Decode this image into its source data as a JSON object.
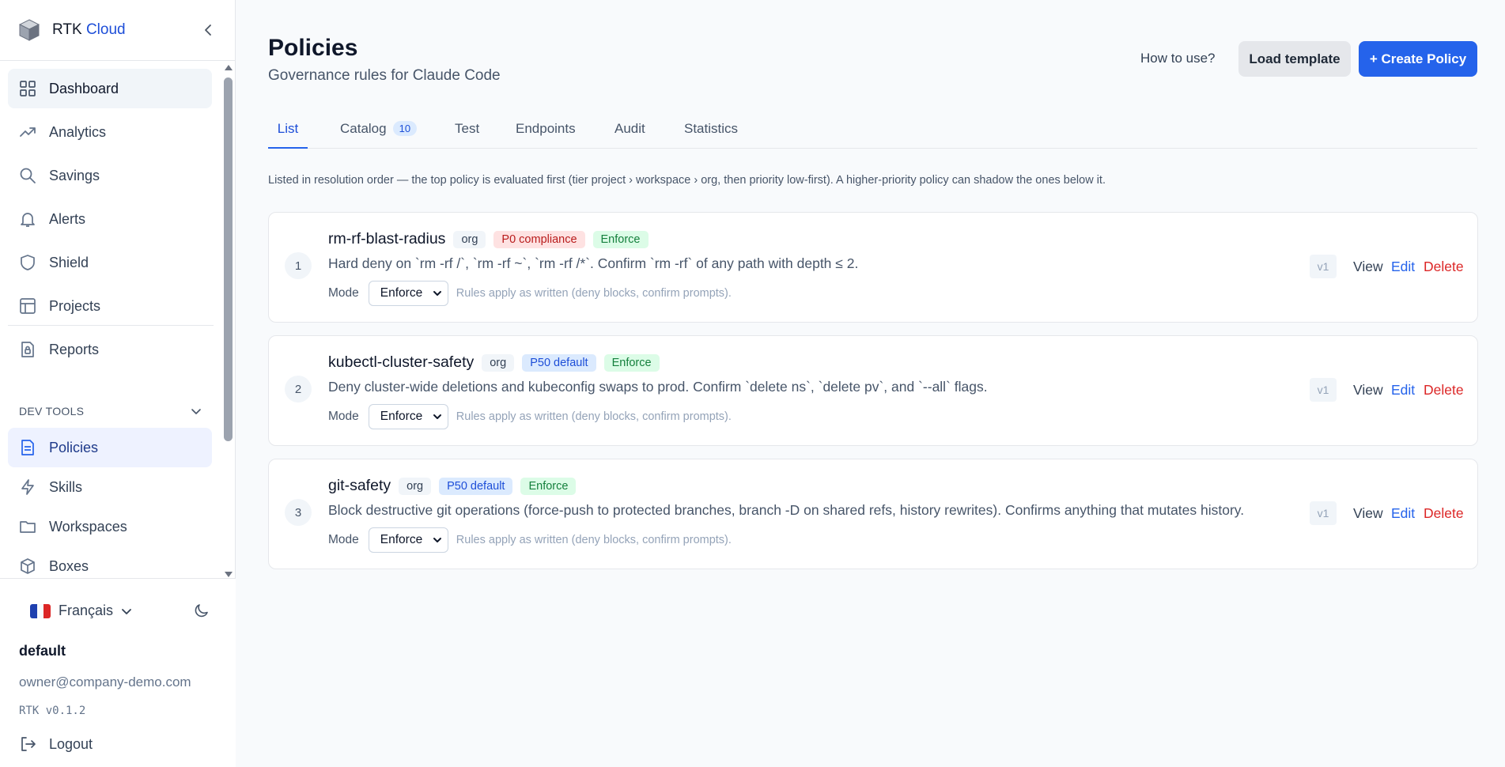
{
  "brand": {
    "name": "RTK",
    "accent": "Cloud"
  },
  "sidebar": {
    "items": [
      {
        "label": "Dashboard",
        "icon": "grid-icon"
      },
      {
        "label": "Analytics",
        "icon": "trend-icon"
      },
      {
        "label": "Savings",
        "icon": "search-icon"
      },
      {
        "label": "Alerts",
        "icon": "bell-icon"
      },
      {
        "label": "Shield",
        "icon": "shield-icon"
      },
      {
        "label": "Projects",
        "icon": "table-icon"
      },
      {
        "label": "Reports",
        "icon": "lock-doc-icon"
      }
    ],
    "section": "DEV TOOLS",
    "dev_items": [
      {
        "label": "Policies",
        "icon": "doc-icon"
      },
      {
        "label": "Skills",
        "icon": "bolt-icon"
      },
      {
        "label": "Workspaces",
        "icon": "folder-icon"
      },
      {
        "label": "Boxes",
        "icon": "box-icon"
      }
    ],
    "language": "Français",
    "org": "default",
    "email": "owner@company-demo.com",
    "version": "RTK v0.1.2",
    "logout": "Logout"
  },
  "header": {
    "title": "Policies",
    "subtitle": "Governance rules for Claude Code",
    "how_to": "How to use?",
    "load_template": "Load template",
    "create_policy": "+ Create Policy"
  },
  "tabs": {
    "list": "List",
    "catalog": "Catalog",
    "catalog_count": "10",
    "test": "Test",
    "endpoints": "Endpoints",
    "audit": "Audit",
    "statistics": "Statistics"
  },
  "hint": "Listed in resolution order — the top policy is evaluated first (tier project › workspace › org, then priority low-first). A higher-priority policy can shadow the ones below it.",
  "policies": [
    {
      "num": "1",
      "name": "rm-rf-blast-radius",
      "scope": "org",
      "priority": "P0 compliance",
      "status": "Enforce",
      "description": "Hard deny on `rm -rf /`, `rm -rf ~`, `rm -rf /*`. Confirm `rm -rf` of any path with depth ≤ 2.",
      "mode_label": "Mode",
      "mode": "Enforce",
      "mode_note": "Rules apply as written (deny blocks, confirm prompts).",
      "version": "v1",
      "view": "View",
      "edit": "Edit",
      "delete": "Delete"
    },
    {
      "num": "2",
      "name": "kubectl-cluster-safety",
      "scope": "org",
      "priority": "P50 default",
      "status": "Enforce",
      "description": "Deny cluster-wide deletions and kubeconfig swaps to prod. Confirm `delete ns`, `delete pv`, and `--all` flags.",
      "mode_label": "Mode",
      "mode": "Enforce",
      "mode_note": "Rules apply as written (deny blocks, confirm prompts).",
      "version": "v1",
      "view": "View",
      "edit": "Edit",
      "delete": "Delete"
    },
    {
      "num": "3",
      "name": "git-safety",
      "scope": "org",
      "priority": "P50 default",
      "status": "Enforce",
      "description": "Block destructive git operations (force-push to protected branches, branch -D on shared refs, history rewrites). Confirms anything that mutates history.",
      "mode_label": "Mode",
      "mode": "Enforce",
      "mode_note": "Rules apply as written (deny blocks, confirm prompts).",
      "version": "v1",
      "view": "View",
      "edit": "Edit",
      "delete": "Delete"
    }
  ],
  "colors": {
    "accent": "#2563eb",
    "danger": "#dc2626",
    "success_bg": "#dcfce7",
    "red_bg": "#fee2e2"
  }
}
